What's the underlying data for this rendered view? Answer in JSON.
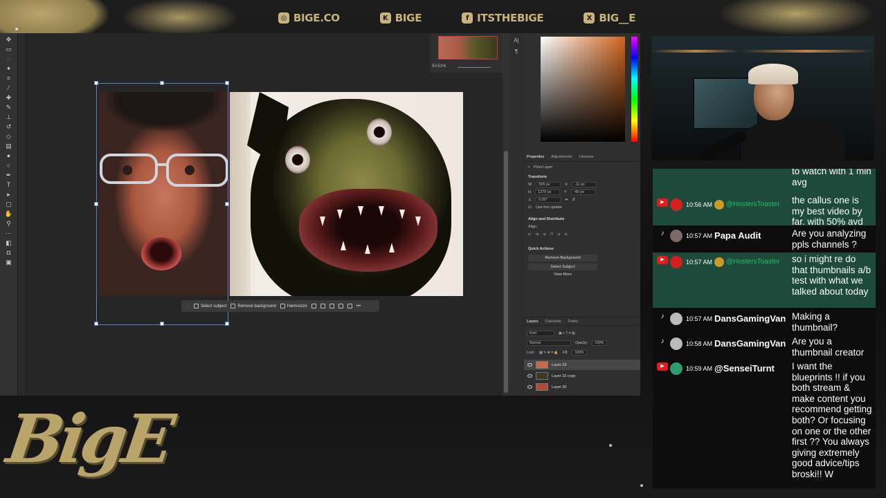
{
  "socials": [
    {
      "icon": "instagram-tiktok-icon",
      "glyph": "◎",
      "handle": "BIGE.CO"
    },
    {
      "icon": "kick-youtube-icon",
      "glyph": "K",
      "handle": "BIGE"
    },
    {
      "icon": "facebook-icon",
      "glyph": "f",
      "handle": "ITSTHEBIGE"
    },
    {
      "icon": "x-icon",
      "glyph": "X",
      "handle": "BIG__E"
    }
  ],
  "brand_logo": "BigE",
  "photoshop": {
    "navigator_zoom": "50.51%",
    "taskbar": {
      "select_subject": "Select subject",
      "remove_background": "Remove background",
      "harmonize": "Harmonize",
      "more": "•••"
    },
    "panel_tabs": [
      "Properties",
      "Adjustments",
      "Libraries"
    ],
    "properties": {
      "layer_type": "Pixel Layer",
      "transform_label": "Transform",
      "w_label": "W",
      "w": "695 px",
      "h_label": "H",
      "h": "1279 px",
      "x_label": "X",
      "x": "-11 px",
      "y_label": "Y",
      "y": "-45 px",
      "angle": "0.00°",
      "use_live_update": "Use live update",
      "align_label": "Align and Distribute",
      "align_sub": "Align:",
      "quick_actions_label": "Quick Actions",
      "remove_background_btn": "Remove Background",
      "select_subject_btn": "Select Subject",
      "view_more": "View More"
    },
    "layers_tabs": [
      "Layers",
      "Channels",
      "Paths"
    ],
    "layers": {
      "kind": "Kind",
      "blend_mode": "Normal",
      "opacity_label": "Opacity:",
      "opacity": "100%",
      "lock_label": "Lock:",
      "fill_label": "Fill:",
      "fill": "100%",
      "items": [
        "Layer 33",
        "Layer 32 copy",
        "Layer 30"
      ]
    }
  },
  "chat": [
    {
      "platform": "youtube",
      "time": "",
      "user": "",
      "text": "to watch with 1 min avg",
      "highlight": true
    },
    {
      "platform": "youtube",
      "time": "10:56 AM",
      "user": "@HostersToaster",
      "green": true,
      "text": "the callus one is my best video by far. with 50% avd",
      "highlight": true
    },
    {
      "platform": "tiktok",
      "time": "10:57 AM",
      "user": "Papa Audit",
      "text": "Are you analyzing ppls channels ?",
      "highlight": false
    },
    {
      "platform": "youtube",
      "time": "10:57 AM",
      "user": "@HostersToaster",
      "green": true,
      "text": "so i might re do that thumbnails a/b test with what we talked about today",
      "highlight": true
    },
    {
      "platform": "tiktok",
      "time": "10:57 AM",
      "user": "DansGamingVan",
      "text": "Making a thumbnail?",
      "highlight": false
    },
    {
      "platform": "tiktok",
      "time": "10:58 AM",
      "user": "DansGamingVan",
      "text": "Are you a thumbnail creator",
      "highlight": false
    },
    {
      "platform": "youtube",
      "time": "10:59 AM",
      "user": "@SenseiTurnt",
      "text": "I want the blueprints !! if you both stream & make content you recommend getting both? Or focusing on one or the other first ?? You always giving extremely good advice/tips broski!! W",
      "highlight": false
    }
  ],
  "colors": {
    "gold": "#c8b47a",
    "chat_highlight": "#1d4a3b",
    "selection_blue": "#5a82c8"
  }
}
